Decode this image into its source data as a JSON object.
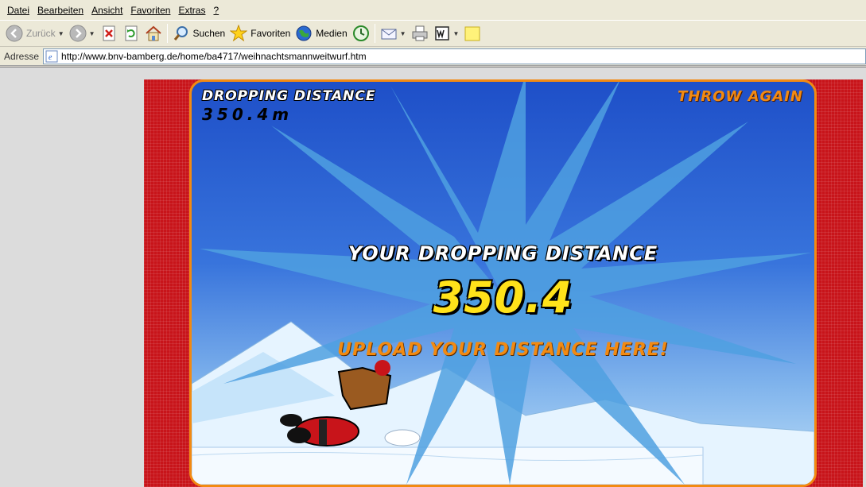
{
  "menu": [
    "Datei",
    "Bearbeiten",
    "Ansicht",
    "Favoriten",
    "Extras",
    "?"
  ],
  "toolbar": {
    "back_label": "Zurück",
    "search_label": "Suchen",
    "favorites_label": "Favoriten",
    "media_label": "Medien"
  },
  "address": {
    "label": "Adresse",
    "url": "http://www.bnv-bamberg.de/home/ba4717/weihnachtsmannweitwurf.htm"
  },
  "game": {
    "distance_label": "DROPPING DISTANCE",
    "distance_value": "350.4m",
    "throw_again": "THROW AGAIN",
    "result_label": "YOUR DROPPING DISTANCE",
    "result_value": "350.4",
    "upload_label": "UPLOAD YOUR DISTANCE HERE!"
  },
  "colors": {
    "accent_orange": "#f28a12",
    "frame_red": "#c8141a",
    "result_yellow": "#ffe21a"
  }
}
